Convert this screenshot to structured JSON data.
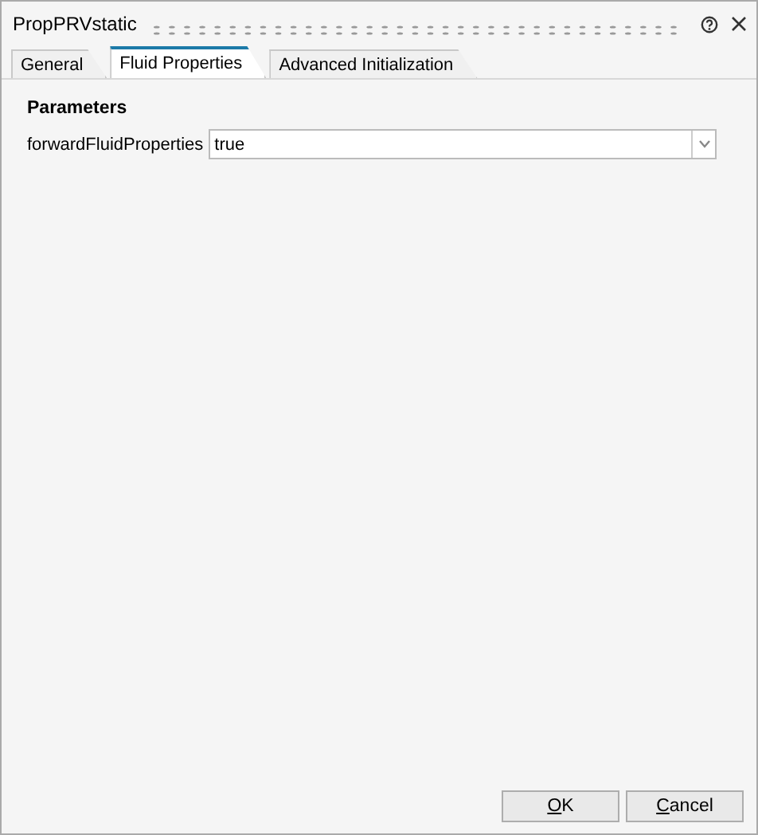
{
  "window": {
    "title": "PropPRVstatic"
  },
  "tabs": [
    {
      "label": "General",
      "selected": false
    },
    {
      "label": "Fluid Properties",
      "selected": true
    },
    {
      "label": "Advanced Initialization",
      "selected": false
    }
  ],
  "section": {
    "title": "Parameters"
  },
  "parameters": [
    {
      "label": "forwardFluidProperties",
      "value": "true"
    }
  ],
  "buttons": [
    "OK",
    "Cancel"
  ]
}
